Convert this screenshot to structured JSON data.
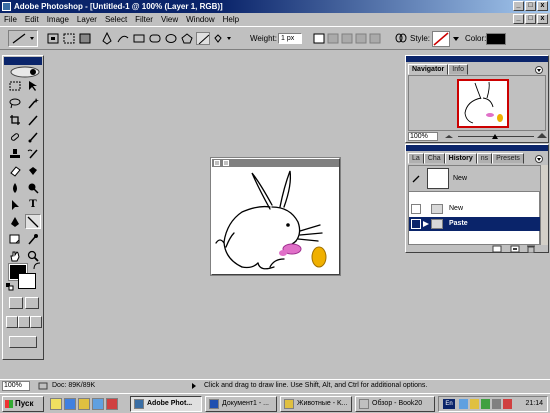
{
  "window": {
    "title": "Adobe Photoshop - [Untitled-1 @ 100% (Layer 1, RGB)]",
    "controls": [
      "_",
      "□",
      "x"
    ]
  },
  "menu": {
    "items": [
      "File",
      "Edit",
      "Image",
      "Layer",
      "Select",
      "Filter",
      "View",
      "Window",
      "Help"
    ]
  },
  "options": {
    "weight_label": "Weight:",
    "weight_value": "1 px",
    "style_label": "Style:",
    "color_label": "Color:",
    "color": "#000000"
  },
  "navigator": {
    "tabs": [
      "Navigator",
      "Info"
    ],
    "zoom": "100%"
  },
  "history": {
    "tabs": [
      "La",
      "Cha",
      "History",
      "ns",
      "Presets"
    ],
    "snapshot_label": "New",
    "items": [
      {
        "label": "New",
        "selected": false
      },
      {
        "label": "Paste",
        "selected": true
      }
    ]
  },
  "document": {
    "title_buttons": [
      "minimize-doc",
      "close-doc"
    ]
  },
  "status": {
    "zoom": "100%",
    "doc": "Doc: 89K/89K",
    "hint": "Click and drag to draw line. Use Shift, Alt, and Ctrl for additional options."
  },
  "taskbar": {
    "start": "Пуск",
    "tasks": [
      {
        "label": "Adobe Phot...",
        "active": true
      },
      {
        "label": "Документ1 - ...",
        "active": false
      },
      {
        "label": "Животные - K...",
        "active": false
      },
      {
        "label": "Обзор - Book20",
        "active": false
      }
    ],
    "lang": "En",
    "clock": "21:14"
  },
  "colors": {
    "title_active": "#0a246a",
    "selection": "#0a246a",
    "nav_view_box": "#cc0000",
    "face": "#c0c0c0"
  }
}
